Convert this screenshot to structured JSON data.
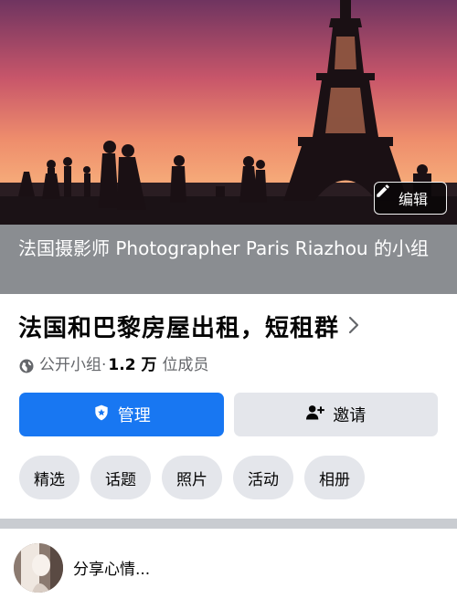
{
  "cover": {
    "edit_label": "编辑"
  },
  "group": {
    "owner_line": "法国摄影师 Photographer Paris Riazhou 的小组",
    "title": "法国和巴黎房屋出租，短租群",
    "privacy_label": "公开小组",
    "separator": " · ",
    "member_count": "1.2 万",
    "members_suffix": "位成员"
  },
  "actions": {
    "manage_label": "管理",
    "invite_label": "邀请"
  },
  "tabs": [
    "精选",
    "话题",
    "照片",
    "活动",
    "相册"
  ],
  "composer": {
    "prompt": "分享心情..."
  },
  "colors": {
    "primary": "#1877f2",
    "chip_bg": "#e4e6eb",
    "owner_bar_bg": "#8a8d91"
  },
  "icons": {
    "edit": "pencil-icon",
    "manage": "shield-icon",
    "invite": "add-person-icon",
    "privacy": "globe-icon",
    "title_chevron": "chevron-right-icon"
  }
}
